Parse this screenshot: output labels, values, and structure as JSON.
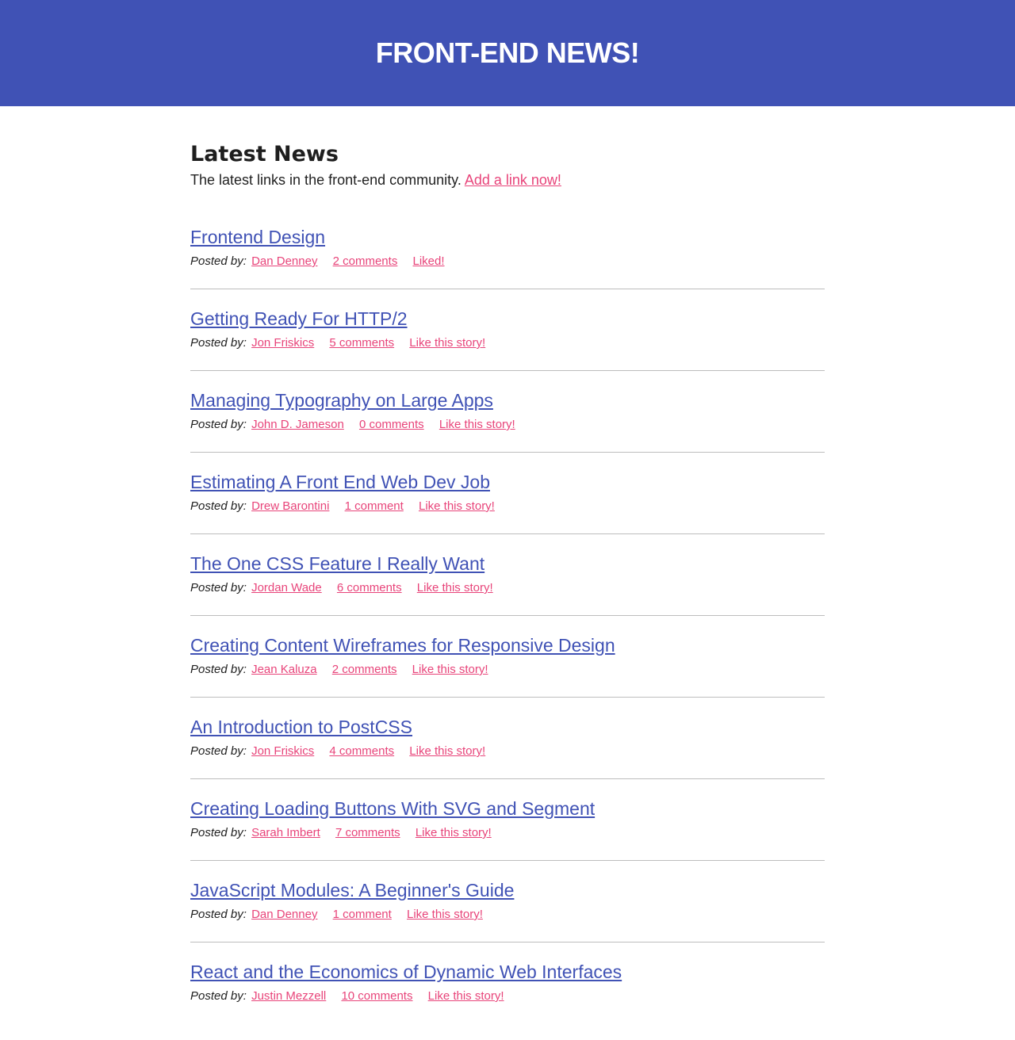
{
  "header": {
    "title": "FRONT-END NEWS!",
    "background": "#4052b5"
  },
  "intro": {
    "heading": "Latest News",
    "text": "The latest links in the front-end community.",
    "add_link_label": "Add a link now!"
  },
  "posted_by_label": "Posted by:",
  "colors": {
    "title_link": "#4052b5",
    "meta_link": "#e8447a"
  },
  "stories": [
    {
      "title": "Frontend Design",
      "author": "Dan Denney",
      "comments": "2 comments",
      "like": "Liked!"
    },
    {
      "title": "Getting Ready For HTTP/2",
      "author": "Jon Friskics",
      "comments": "5 comments",
      "like": "Like this story!"
    },
    {
      "title": "Managing Typography on Large Apps",
      "author": "John D. Jameson",
      "comments": "0 comments",
      "like": "Like this story!"
    },
    {
      "title": "Estimating A Front End Web Dev Job",
      "author": "Drew Barontini",
      "comments": "1 comment",
      "like": "Like this story!"
    },
    {
      "title": "The One CSS Feature I Really Want",
      "author": "Jordan Wade",
      "comments": "6 comments",
      "like": "Like this story!"
    },
    {
      "title": "Creating Content Wireframes for Responsive Design",
      "author": "Jean Kaluza",
      "comments": "2 comments",
      "like": "Like this story!"
    },
    {
      "title": "An Introduction to PostCSS",
      "author": "Jon Friskics",
      "comments": "4 comments",
      "like": "Like this story!"
    },
    {
      "title": "Creating Loading Buttons With SVG and Segment",
      "author": "Sarah Imbert",
      "comments": "7 comments",
      "like": "Like this story!"
    },
    {
      "title": "JavaScript Modules: A Beginner's Guide",
      "author": "Dan Denney",
      "comments": "1 comment",
      "like": "Like this story!"
    },
    {
      "title": "React and the Economics of Dynamic Web Interfaces",
      "author": "Justin Mezzell",
      "comments": "10 comments",
      "like": "Like this story!"
    }
  ]
}
